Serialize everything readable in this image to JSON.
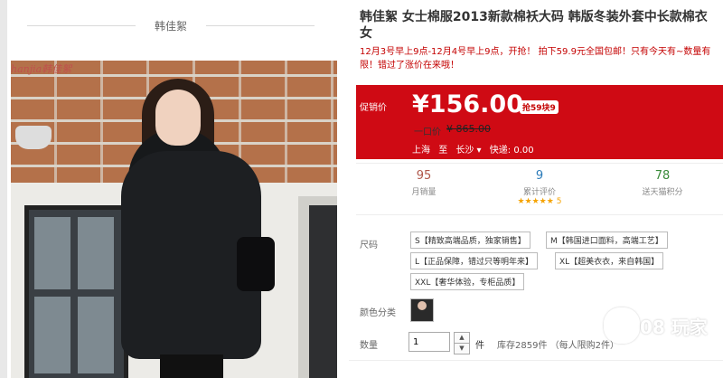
{
  "brand": {
    "name": "韩佳絮",
    "logo_text": "hanjia韩佳絮"
  },
  "product": {
    "title": "韩佳絮 女士棉服2013新款棉袄大码 韩版冬装外套中长款棉衣女",
    "promo_text": "12月3号早上9点-12月4号早上9点，开抢！ 拍下59.9元全国包邮！只有今天有~数量有限！错过了涨价在来哦！"
  },
  "price": {
    "label": "促销价",
    "value": "¥156.00",
    "badge": "抢59块9",
    "original_label": "一口价",
    "original_value": "¥ 865.00",
    "ship_from": "上海",
    "ship_to_word": "至",
    "ship_to": "长沙 ▾",
    "shipping": "快递: 0.00"
  },
  "stats": {
    "sales_num": "95",
    "sales_label": "月销量",
    "reviews_num": "9",
    "reviews_label": "累计评价",
    "stars": "★★★★★",
    "rating": "5",
    "points_num": "78",
    "points_label": "送天猫积分"
  },
  "sizes": {
    "label": "尺码",
    "options": [
      "S【精致高端品质，独家销售】",
      "M【韩国进口面料，高端工艺】",
      "L【正品保障，错过只等明年来】",
      "XL【超美衣衣，来自韩国】",
      "XXL【奢华体验，专柜品质】"
    ]
  },
  "color": {
    "label": "颜色分类"
  },
  "quantity": {
    "label": "数量",
    "value": "1",
    "unit": "件",
    "stock": "库存2859件   （每人限购2件）"
  },
  "watermark": {
    "text": "08 玩家"
  },
  "colors": {
    "price_bg": "#cf0a14",
    "accent_red": "#c40000",
    "sales_color": "#b0574a",
    "reviews_color": "#2b7bb9",
    "points_color": "#3a8b3a"
  }
}
